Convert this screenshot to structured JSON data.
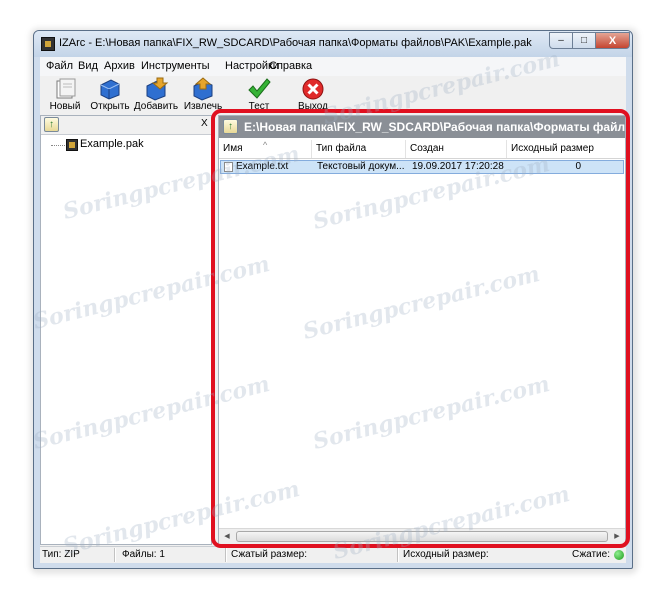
{
  "window": {
    "title": "IZArc - E:\\Новая папка\\FIX_RW_SDCARD\\Рабочая папка\\Форматы файлов\\PAK\\Example.pak",
    "buttons": {
      "minimize": "–",
      "maximize": "□",
      "close": "X"
    }
  },
  "menu": [
    "Файл",
    "Вид",
    "Архив",
    "Инструменты",
    "Настройки",
    "Справка"
  ],
  "toolbar": [
    {
      "label": "Новый",
      "icon": "new-archive-icon"
    },
    {
      "label": "Открыть",
      "icon": "open-archive-icon"
    },
    {
      "label": "Добавить",
      "icon": "add-files-icon"
    },
    {
      "label": "Извлечь",
      "icon": "extract-icon"
    },
    {
      "label": "Тест",
      "icon": "test-checkmark-icon"
    },
    {
      "label": "Выход",
      "icon": "exit-icon"
    }
  ],
  "left_panel": {
    "close_label": "X",
    "tree": [
      {
        "label": "Example.pak"
      }
    ]
  },
  "right_panel": {
    "path": "E:\\Новая папка\\FIX_RW_SDCARD\\Рабочая папка\\Форматы файлов\\PAK\\Example.pak",
    "columns": [
      "Имя",
      "Тип файла",
      "Создан",
      "Исходный размер"
    ],
    "rows": [
      {
        "name": "Example.txt",
        "type": "Текстовый докум...",
        "created": "19.09.2017 17:20:28",
        "size": "0"
      }
    ]
  },
  "status": {
    "type": "Тип: ZIP",
    "files": "Файлы: 1",
    "compressed": "Сжатый размер:",
    "original": "Исходный размер:",
    "compression": "Сжатие:"
  },
  "colors": {
    "highlight": "#e01020",
    "status_light": "#1b9a1b"
  },
  "watermark": "Soringpcrepair.com"
}
